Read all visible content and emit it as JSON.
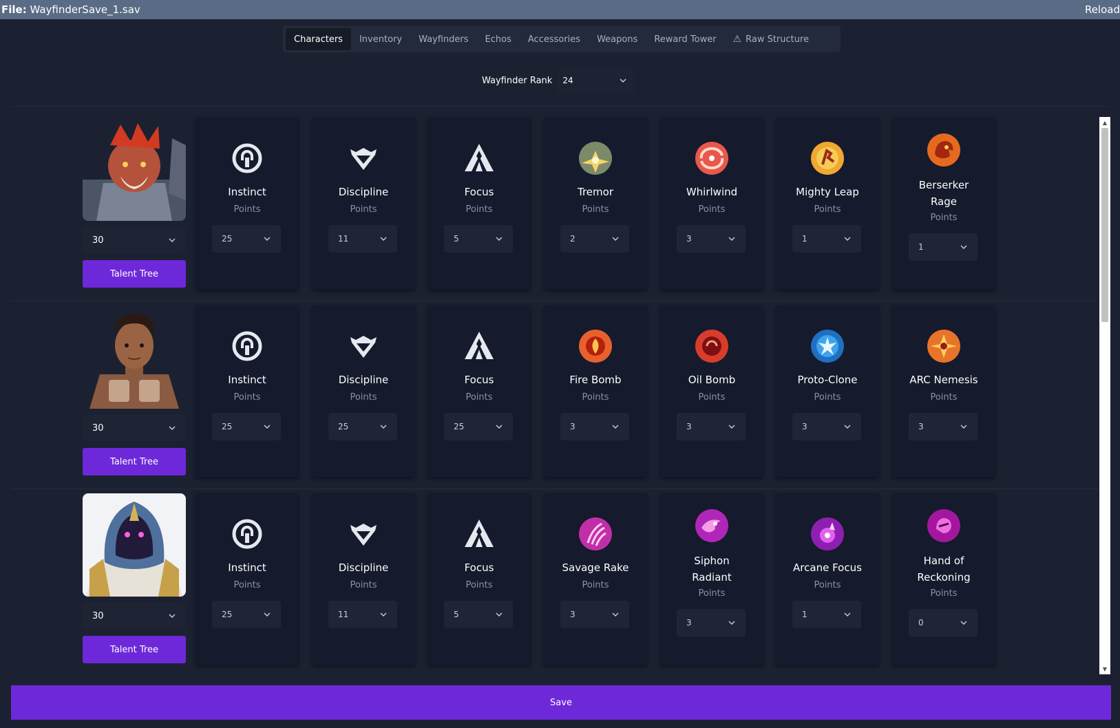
{
  "titlebar": {
    "file_label": "File:",
    "file_name": "WayfinderSave_1.sav",
    "reload": "Reload"
  },
  "tabs": [
    {
      "label": "Characters",
      "active": true
    },
    {
      "label": "Inventory"
    },
    {
      "label": "Wayfinders"
    },
    {
      "label": "Echos"
    },
    {
      "label": "Accessories"
    },
    {
      "label": "Weapons"
    },
    {
      "label": "Reward Tower"
    },
    {
      "label": "Raw Structure",
      "icon": "warning-icon"
    }
  ],
  "rank": {
    "label": "Wayfinder Rank",
    "value": "24"
  },
  "points_label": "Points",
  "talent_label": "Talent Tree",
  "save_label": "Save",
  "characters": [
    {
      "portrait": "horned-warrior-portrait",
      "level": "30",
      "cards": [
        {
          "name": "Instinct",
          "icon": "instinct-icon",
          "value": "25"
        },
        {
          "name": "Discipline",
          "icon": "discipline-icon",
          "value": "11"
        },
        {
          "name": "Focus",
          "icon": "focus-icon",
          "value": "5"
        },
        {
          "name": "Tremor",
          "icon": "tremor-icon",
          "value": "2"
        },
        {
          "name": "Whirlwind",
          "icon": "whirlwind-icon",
          "value": "3"
        },
        {
          "name": "Mighty Leap",
          "icon": "mighty-leap-icon",
          "value": "1"
        },
        {
          "name_line1": "Berserker",
          "name_line2": "Rage",
          "icon": "berserker-rage-icon",
          "value": "1"
        }
      ]
    },
    {
      "portrait": "soldier-portrait",
      "level": "30",
      "cards": [
        {
          "name": "Instinct",
          "icon": "instinct-icon",
          "value": "25"
        },
        {
          "name": "Discipline",
          "icon": "discipline-icon",
          "value": "25"
        },
        {
          "name": "Focus",
          "icon": "focus-icon",
          "value": "25"
        },
        {
          "name": "Fire Bomb",
          "icon": "fire-bomb-icon",
          "value": "3"
        },
        {
          "name": "Oil Bomb",
          "icon": "oil-bomb-icon",
          "value": "3"
        },
        {
          "name": "Proto-Clone",
          "icon": "proto-clone-icon",
          "value": "3"
        },
        {
          "name": "ARC Nemesis",
          "icon": "arc-nemesis-icon",
          "value": "3"
        }
      ]
    },
    {
      "portrait": "hooded-mage-portrait",
      "level": "30",
      "cards": [
        {
          "name": "Instinct",
          "icon": "instinct-icon",
          "value": "25"
        },
        {
          "name": "Discipline",
          "icon": "discipline-icon",
          "value": "11"
        },
        {
          "name": "Focus",
          "icon": "focus-icon",
          "value": "5"
        },
        {
          "name": "Savage Rake",
          "icon": "savage-rake-icon",
          "value": "3"
        },
        {
          "name_line1": "Siphon",
          "name_line2": "Radiant",
          "icon": "siphon-radiant-icon",
          "value": "3"
        },
        {
          "name": "Arcane Focus",
          "icon": "arcane-focus-icon",
          "value": "1"
        },
        {
          "name_line1": "Hand of",
          "name_line2": "Reckoning",
          "icon": "hand-of-reckoning-icon",
          "value": "0"
        }
      ]
    }
  ]
}
